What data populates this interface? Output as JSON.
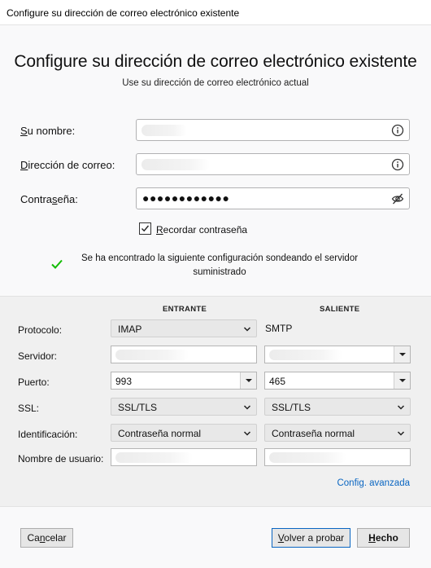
{
  "window": {
    "title": "Configure su dirección de correo electrónico existente"
  },
  "header": {
    "title": "Configure su dirección de correo electrónico existente",
    "subtitle": "Use su dirección de correo electrónico actual"
  },
  "account": {
    "name_label_accel": "S",
    "name_label_rest": "u nombre:",
    "email_label_accel": "D",
    "email_label_rest": "irección de correo:",
    "password_label_pre": "Contra",
    "password_label_accel": "s",
    "password_label_post": "eña:",
    "password_value": "●●●●●●●●●●●●",
    "remember_accel": "R",
    "remember_rest": "ecordar contraseña",
    "remember_checked": true
  },
  "status": {
    "found_message": "Se ha encontrado la siguiente configuración sondeando el servidor suministrado",
    "check_color": "#12bc00"
  },
  "server": {
    "incoming_header": "ENTRANTE",
    "outgoing_header": "SALIENTE",
    "labels": {
      "protocol": "Protocolo:",
      "server": "Servidor:",
      "port": "Puerto:",
      "ssl": "SSL:",
      "auth": "Identificación:",
      "username": "Nombre de usuario:"
    },
    "incoming": {
      "protocol": "IMAP",
      "port": "993",
      "ssl": "SSL/TLS",
      "auth": "Contraseña normal"
    },
    "outgoing": {
      "protocol": "SMTP",
      "port": "465",
      "ssl": "SSL/TLS",
      "auth": "Contraseña normal"
    },
    "advanced_link": "Config. avanzada"
  },
  "footer": {
    "cancel_accel": "n",
    "cancel_pre": "Ca",
    "cancel_post": "celar",
    "retest_accel": "V",
    "retest_rest": "olver a probar",
    "done_accel": "H",
    "done_rest": "echo"
  },
  "colors": {
    "accent": "#0a66c2",
    "panel_bg": "#f0f0f0"
  }
}
